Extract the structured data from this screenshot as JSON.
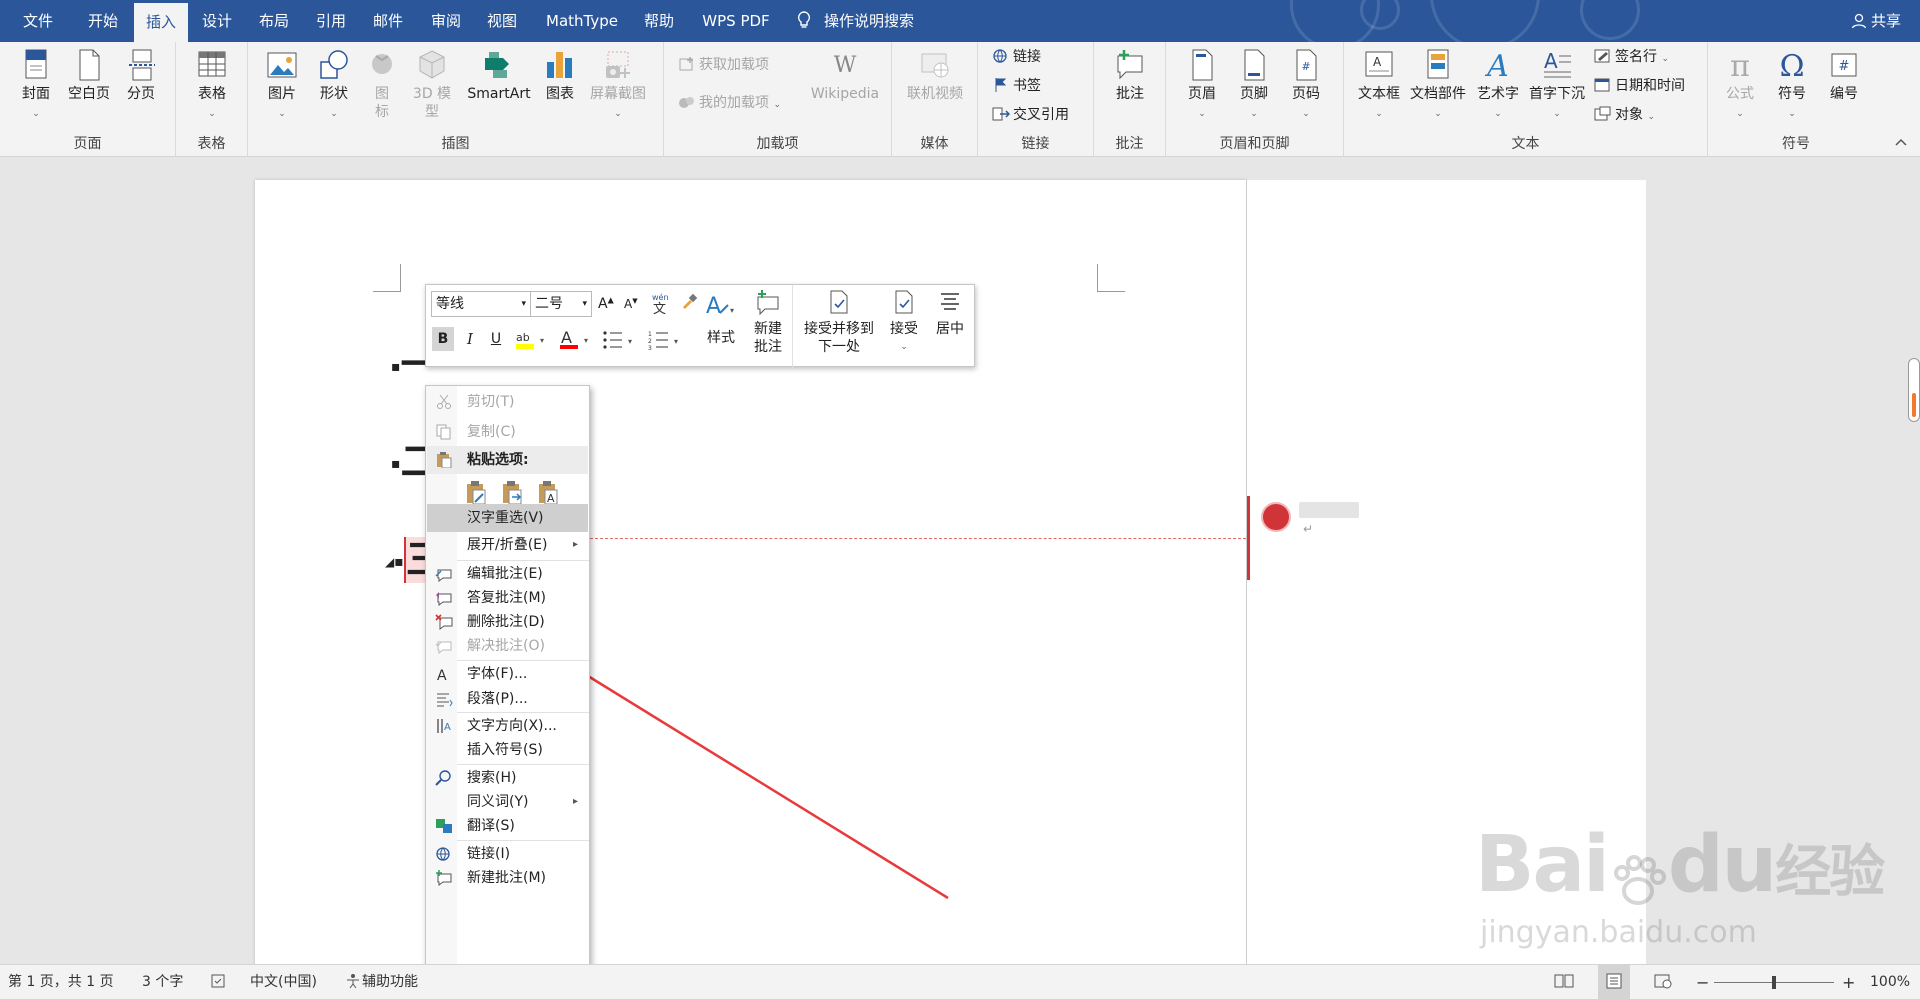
{
  "tabs": {
    "file": "文件",
    "home": "开始",
    "insert": "插入",
    "design": "设计",
    "layout": "布局",
    "references": "引用",
    "mailings": "邮件",
    "review": "审阅",
    "view": "视图",
    "mathtype": "MathType",
    "help": "帮助",
    "wpspdf": "WPS PDF",
    "tell_me": "操作说明搜索",
    "share": "共享"
  },
  "ribbon": {
    "pages": {
      "label": "页面",
      "cover": "封面",
      "blank": "空白页",
      "break": "分页"
    },
    "tables": {
      "label": "表格",
      "table": "表格"
    },
    "illustrations": {
      "label": "插图",
      "picture": "图片",
      "shapes": "形状",
      "icons": "图标",
      "model3d": "3D 模型",
      "smartart": "SmartArt",
      "chart": "图表",
      "screenshot": "屏幕截图"
    },
    "addins": {
      "label": "加载项",
      "get": "获取加载项",
      "mine": "我的加载项",
      "wikipedia": "Wikipedia"
    },
    "media": {
      "label": "媒体",
      "video": "联机视频"
    },
    "links": {
      "label": "链接",
      "link": "链接",
      "bookmark": "书签",
      "crossref": "交叉引用"
    },
    "comments": {
      "label": "批注",
      "comment": "批注"
    },
    "header_footer": {
      "label": "页眉和页脚",
      "header": "页眉",
      "footer": "页脚",
      "pagenum": "页码"
    },
    "text": {
      "label": "文本",
      "textbox": "文本框",
      "parts": "文档部件",
      "wordart": "艺术字",
      "dropcap": "首字下沉",
      "sigline": "签名行",
      "datetime": "日期和时间",
      "object": "对象"
    },
    "symbols": {
      "label": "符号",
      "equation": "公式",
      "symbol": "符号",
      "number": "编号"
    }
  },
  "mini_toolbar": {
    "font": "等线",
    "size": "二号",
    "bold": "B",
    "italic": "I",
    "underline": "U",
    "styles": "样式",
    "new_comment": "新建\n批注",
    "accept_next": "接受并移到\n下一处",
    "accept": "接受",
    "center": "居中"
  },
  "context_menu": {
    "cut": "剪切(T)",
    "copy": "复制(C)",
    "paste_options": "粘贴选项:",
    "reconvert": "汉字重选(V)",
    "expand": "展开/折叠(E)",
    "edit_comment": "编辑批注(E)",
    "reply_comment": "答复批注(M)",
    "delete_comment": "删除批注(D)",
    "resolve_comment": "解决批注(O)",
    "font": "字体(F)...",
    "paragraph": "段落(P)...",
    "text_direction": "文字方向(X)...",
    "insert_symbol": "插入符号(S)",
    "search": "搜索(H)",
    "synonyms": "同义词(Y)",
    "translate": "翻译(S)",
    "link": "链接(I)",
    "new_comment": "新建批注(M)"
  },
  "document": {
    "line1": "一",
    "line2": "二",
    "line3": "三",
    "para_mark": "↵"
  },
  "status": {
    "page": "第 1 页，共 1 页",
    "words": "3 个字",
    "lang": "中文(中国)",
    "accessibility": "辅助功能",
    "zoom": "100%"
  },
  "watermark": {
    "brand": "Bai",
    "brand2": "du",
    "cn": "经验",
    "url": "jingyan.baidu.com"
  },
  "colors": {
    "accent": "#2b579a",
    "arrow": "#e8393b",
    "comment": "#d13438"
  }
}
